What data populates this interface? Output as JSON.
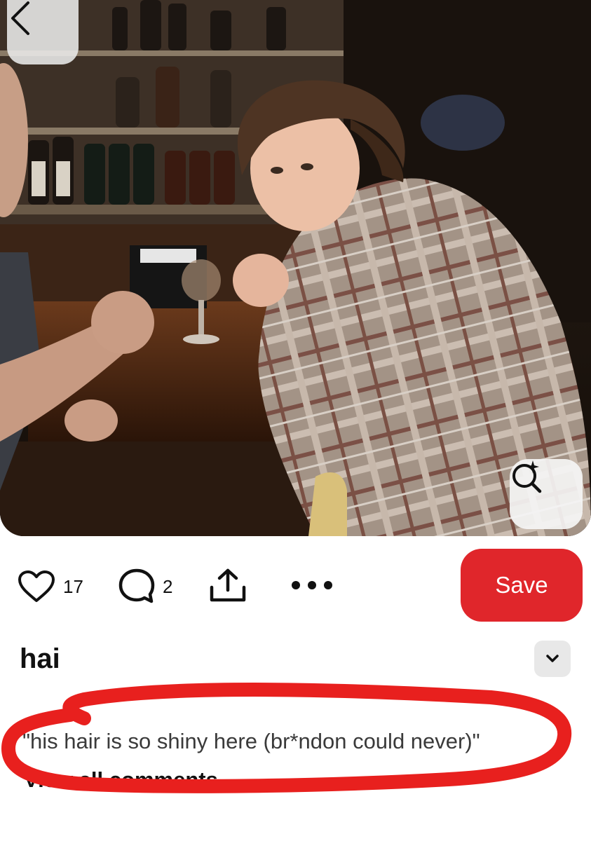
{
  "pin": {
    "title": "hai",
    "image_alt": "Young man in a plaid jacket at a bar, looking back over his shoulder"
  },
  "actions": {
    "like_count": "17",
    "comment_count": "2",
    "save_label": "Save"
  },
  "comment": {
    "text": "\"his hair is so shiny here (br*ndon could never)\"",
    "trailing": ".",
    "view_all_label": "View all comments"
  },
  "icons": {
    "back": "chevron-left-icon",
    "visual_search": "lens-sparkle-icon",
    "like": "heart-icon",
    "comment": "speech-bubble-icon",
    "share": "share-icon",
    "more": "more-dots-icon",
    "expand": "chevron-down-icon"
  },
  "colors": {
    "save_button": "#e0262b",
    "annotation_circle": "#e8201e"
  }
}
